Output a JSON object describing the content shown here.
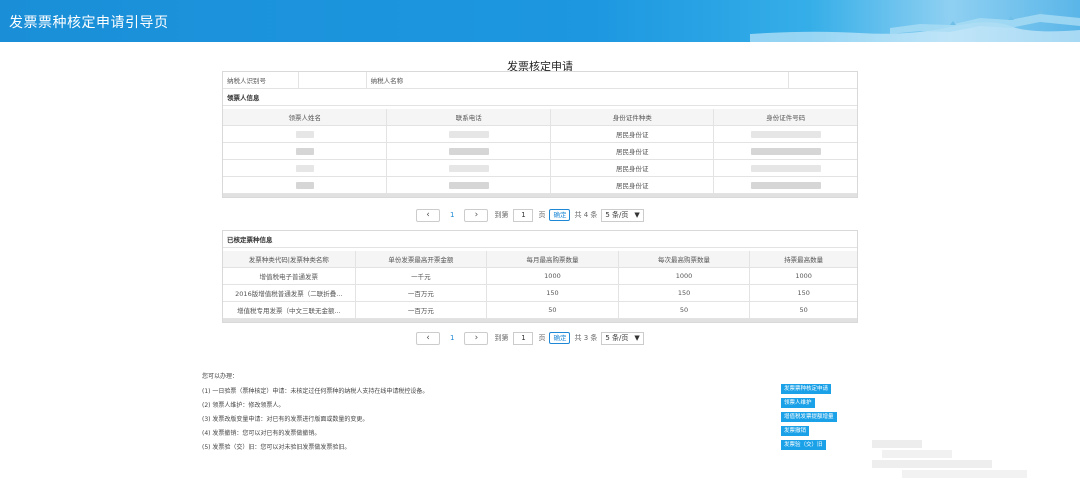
{
  "header": {
    "title": "发票票种核定申请引导页"
  },
  "page_title": "发票核定申请",
  "taxpayer": {
    "id_label": "纳税人识别号",
    "id_value": "",
    "name_label": "纳税人名称",
    "name_value": ""
  },
  "recipient_section": {
    "title": "领票人信息",
    "columns": [
      "领票人姓名",
      "联系电话",
      "身份证件种类",
      "身份证件号码"
    ],
    "rows": [
      {
        "id_type": "居民身份证"
      },
      {
        "id_type": "居民身份证"
      },
      {
        "id_type": "居民身份证"
      },
      {
        "id_type": "居民身份证"
      }
    ],
    "pager": {
      "current": "1",
      "goto_prefix": "到第",
      "goto_value": "1",
      "goto_suffix": "页",
      "confirm": "确定",
      "total": "共 4 条",
      "page_size": "5 条/页"
    }
  },
  "invoice_section": {
    "title": "已核定票种信息",
    "columns": [
      "发票种类代码|发票种类名称",
      "单份发票最高开票金额",
      "每月最高购票数量",
      "每次最高购票数量",
      "持票最高数量"
    ],
    "rows": [
      {
        "name": "增值税电子普通发票",
        "max_amount": "一千元",
        "monthly": "1000",
        "per_time": "1000",
        "hold": "1000"
      },
      {
        "name": "2016版增值税普通发票（二联折叠...",
        "max_amount": "一百万元",
        "monthly": "150",
        "per_time": "150",
        "hold": "150"
      },
      {
        "name": "增值税专用发票（中文三联无金额...",
        "max_amount": "一百万元",
        "monthly": "50",
        "per_time": "50",
        "hold": "50"
      }
    ],
    "pager": {
      "current": "1",
      "goto_prefix": "到第",
      "goto_value": "1",
      "goto_suffix": "页",
      "confirm": "确定",
      "total": "共 3 条",
      "page_size": "5 条/页"
    }
  },
  "operations": {
    "intro": "您可以办理：",
    "items": [
      "(1) 一日验票（票种核定）申请：未核定过任何票种的纳税人支持在线申请税控设备。",
      "(2) 领票人维护：修改领票人。",
      "(3) 发票改版变量申请：对已有的发票进行版面或数量的变更。",
      "(4) 发票撤销：您可以对已有的发票做撤销。",
      "(5) 发票验（交）旧：您可以对未验旧发票做发票验旧。"
    ],
    "buttons": [
      "发票票种核定申请",
      "领票人维护",
      "增值税发票提额增量",
      "发票撤销",
      "发票验（交）旧"
    ]
  },
  "colors": {
    "accent": "#1ba1e8",
    "header_blue": "#1a8fd8"
  }
}
